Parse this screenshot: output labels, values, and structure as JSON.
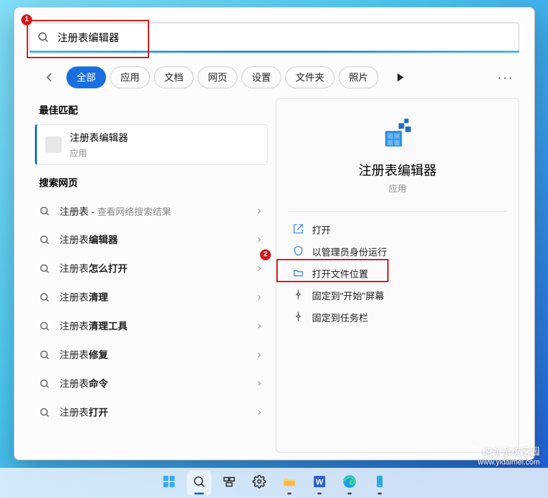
{
  "search": {
    "value": "注册表编辑器"
  },
  "filters": {
    "items": [
      {
        "label": "全部",
        "active": true
      },
      {
        "label": "应用"
      },
      {
        "label": "文档"
      },
      {
        "label": "网页"
      },
      {
        "label": "设置"
      },
      {
        "label": "文件夹"
      },
      {
        "label": "照片"
      }
    ]
  },
  "left": {
    "best_match_heading": "最佳匹配",
    "best_match": {
      "title": "注册表编辑器",
      "sub": "应用"
    },
    "web_heading": "搜索网页",
    "web_items": [
      {
        "prefix": "注册表",
        "suffix_html": " - <span class='muted'>查看网络搜索结果</span>"
      },
      {
        "prefix": "注册表",
        "bold": "编辑器"
      },
      {
        "prefix": "注册表",
        "bold": "怎么打开"
      },
      {
        "prefix": "注册表",
        "bold": "清理"
      },
      {
        "prefix": "注册表",
        "bold": "清理工具"
      },
      {
        "prefix": "注册表",
        "bold": "修复"
      },
      {
        "prefix": "注册表",
        "bold": "命令"
      },
      {
        "prefix": "注册表",
        "bold": "打开"
      }
    ]
  },
  "right": {
    "title": "注册表编辑器",
    "sub": "应用",
    "actions": [
      {
        "icon": "open",
        "label": "打开"
      },
      {
        "icon": "shield",
        "label": "以管理员身份运行"
      },
      {
        "icon": "folder",
        "label": "打开文件位置"
      },
      {
        "icon": "pin",
        "label": "固定到\"开始\"屏幕"
      },
      {
        "icon": "pin",
        "label": "固定到任务栏"
      }
    ]
  },
  "callouts": {
    "one": "1",
    "two": "2"
  },
  "taskbar": {
    "items": [
      {
        "name": "start",
        "state": ""
      },
      {
        "name": "search",
        "state": "selected"
      },
      {
        "name": "taskview",
        "state": ""
      },
      {
        "name": "settings",
        "state": ""
      },
      {
        "name": "explorer",
        "state": "active"
      },
      {
        "name": "word",
        "state": "active"
      },
      {
        "name": "edge",
        "state": "active"
      },
      {
        "name": "phone",
        "state": "active"
      }
    ]
  },
  "watermark": {
    "line1": "纯净系统家园",
    "line2": "www.yidaimei.com"
  }
}
